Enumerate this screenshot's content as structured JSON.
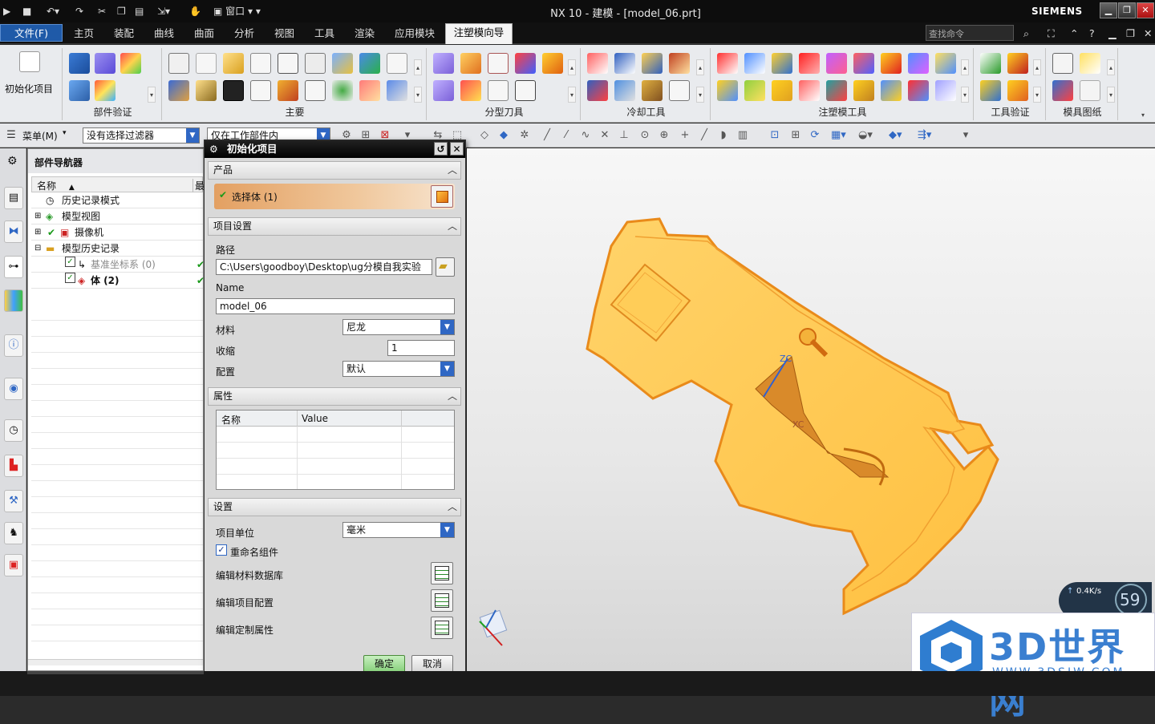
{
  "titlebar": {
    "title": "NX 10 - 建模 - [model_06.prt]",
    "window_menu": "窗口",
    "brand": "SIEMENS",
    "search_placeholder": "查找命令"
  },
  "menubar": {
    "file": "文件(F)",
    "tabs": [
      "主页",
      "装配",
      "曲线",
      "曲面",
      "分析",
      "视图",
      "工具",
      "渲染",
      "应用模块",
      "注塑模向导"
    ]
  },
  "ribbon": {
    "init_project": "初始化项目",
    "groups": [
      "部件验证",
      "主要",
      "分型刀具",
      "冷却工具",
      "注塑模工具",
      "工具验证",
      "模具图纸"
    ]
  },
  "toolbar": {
    "menu": "菜单(M)",
    "filter": "没有选择过滤器",
    "scope": "仅在工作部件内"
  },
  "navigator": {
    "title": "部件导航器",
    "col_name": "名称",
    "col_2": "最",
    "rows": [
      "历史记录模式",
      "模型视图",
      "摄像机",
      "模型历史记录",
      "基准坐标系 (0)",
      "体 (2)"
    ]
  },
  "dialog": {
    "title": "初始化项目",
    "product_section": "产品",
    "select_body": "选择体 (1)",
    "project_section": "项目设置",
    "path_label": "路径",
    "path_value": "C:\\Users\\goodboy\\Desktop\\ug分模自我实验",
    "name_label": "Name",
    "name_value": "model_06",
    "material_label": "材料",
    "material_value": "尼龙",
    "shrink_label": "收缩",
    "shrink_value": "1",
    "config_label": "配置",
    "config_value": "默认",
    "attr_section": "属性",
    "attr_col_name": "名称",
    "attr_col_value": "Value",
    "settings_section": "设置",
    "unit_label": "项目单位",
    "unit_value": "毫米",
    "rename_label": "重命名组件",
    "edit_material_db": "编辑材料数据库",
    "edit_project_config": "编辑项目配置",
    "edit_custom_attr": "编辑定制属性",
    "ok": "确定",
    "cancel": "取消"
  },
  "viewport": {
    "axis_zc": "ZC",
    "axis_xc": "XC"
  },
  "overlay": {
    "net_speed": "0.4K/s",
    "percent": "59",
    "logo_text": "3D世界网",
    "logo_url": "WWW.3DSJW.COM"
  },
  "colors": {
    "part": "#ffc94a",
    "part_edge": "#e98a1a",
    "accent": "#2f67c4"
  }
}
